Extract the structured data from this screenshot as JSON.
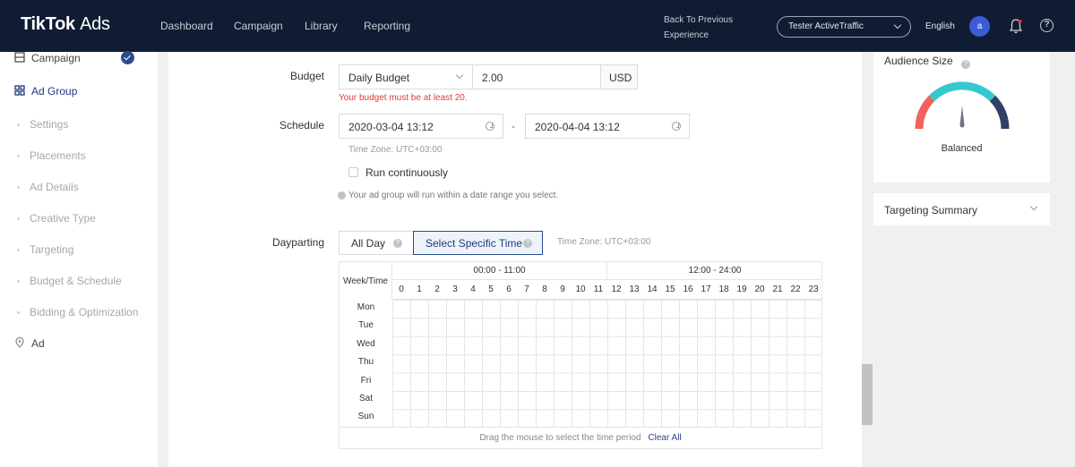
{
  "header": {
    "logo_brand": "TikTok",
    "logo_suffix": "Ads",
    "nav": [
      "Dashboard",
      "Campaign",
      "Library",
      "Reporting"
    ],
    "back_link_line1": "Back To Previous",
    "back_link_line2": "Experience",
    "account": "Tester ActiveTraffic",
    "language": "English",
    "avatar_letter": "a",
    "help_glyph": "?"
  },
  "sidebar": {
    "campaign": "Campaign",
    "ad_group": "Ad Group",
    "sub_items": [
      "Settings",
      "Placements",
      "Ad Details",
      "Creative Type",
      "Targeting",
      "Budget & Schedule",
      "Bidding & Optimization"
    ],
    "ad": "Ad"
  },
  "budget": {
    "label": "Budget",
    "type": "Daily Budget",
    "amount": "2.00",
    "currency": "USD",
    "error": "Your budget must be at least 20."
  },
  "schedule": {
    "label": "Schedule",
    "start": "2020-03-04 13:12",
    "separator": "-",
    "end": "2020-04-04 13:12",
    "timezone": "Time Zone: UTC+03:00",
    "run_continuously": "Run continuously",
    "note": "Your ad group will run within a date range you select."
  },
  "dayparting": {
    "label": "Dayparting",
    "all_day": "All Day",
    "specific": "Select Specific Time",
    "timezone": "Time Zone: UTC+03:00",
    "week_time": "Week/Time",
    "range_am": "00:00 - 11:00",
    "range_pm": "12:00 - 24:00",
    "hours": [
      "0",
      "1",
      "2",
      "3",
      "4",
      "5",
      "6",
      "7",
      "8",
      "9",
      "10",
      "11",
      "12",
      "13",
      "14",
      "15",
      "16",
      "17",
      "18",
      "19",
      "20",
      "21",
      "22",
      "23"
    ],
    "days": [
      "Mon",
      "Tue",
      "Wed",
      "Thu",
      "Fri",
      "Sat",
      "Sun"
    ],
    "footer_hint": "Drag the mouse to select the time period",
    "clear_all": "Clear All"
  },
  "right_panel": {
    "audience_size": "Audience Size",
    "gauge_label": "Balanced",
    "targeting_summary": "Targeting Summary"
  },
  "colors": {
    "nav_bg": "#0f1c33",
    "accent": "#2b4c8c",
    "error": "#e03b3b",
    "gauge_red": "#f0625a",
    "gauge_teal": "#35c9cf",
    "gauge_navy": "#2f3f66"
  }
}
